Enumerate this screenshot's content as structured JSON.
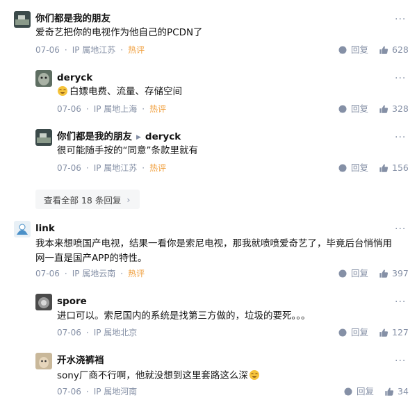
{
  "comments": [
    {
      "name": "你们都是我的朋友",
      "content": "爱奇艺把你的电视作为他自己的PCDN了",
      "date": "07-06",
      "location": "IP 属地江苏",
      "tag": "热评",
      "reply_label": "回复",
      "likes": "628",
      "replies": [
        {
          "name": "deryck",
          "content": "白嫖电费、流量、存储空间",
          "date": "07-06",
          "location": "IP 属地上海",
          "tag": "热评",
          "reply_label": "回复",
          "likes": "328"
        },
        {
          "name": "你们都是我的朋友",
          "reply_to": "deryck",
          "content": "很可能随手按的“同意”条款里就有",
          "date": "07-06",
          "location": "IP 属地江苏",
          "tag": "热评",
          "reply_label": "回复",
          "likes": "156"
        }
      ],
      "view_all": "查看全部 18 条回复"
    },
    {
      "name": "link",
      "content_line1": "我本来想喷国产电视，结果一看你是索尼电视，那我就喷喷爱奇艺了，毕竟后台悄悄用",
      "content_line2": "网一直是国产APP的特性。",
      "date": "07-06",
      "location": "IP 属地云南",
      "tag": "热评",
      "reply_label": "回复",
      "likes": "397",
      "replies": [
        {
          "name": "spore",
          "content": "进口可以。索尼国内的系统是找第三方做的，垃圾的要死。。。",
          "date": "07-06",
          "location": "IP 属地北京",
          "reply_label": "回复",
          "likes": "127"
        },
        {
          "name": "开水浇裤裆",
          "content": "sony厂商不行啊，他就没想到这里套路这么深",
          "date": "07-06",
          "location": "IP 属地河南",
          "reply_label": "回复",
          "likes": "34"
        }
      ]
    }
  ],
  "more_icon": "more-dots-icon",
  "colors": {
    "hot": "#f09e3b",
    "meta": "#8590a6",
    "text": "#121212"
  }
}
